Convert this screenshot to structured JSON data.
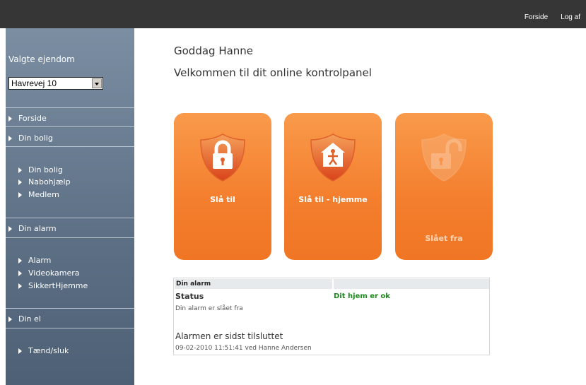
{
  "topbar": {
    "links": [
      "Forside",
      "Log af"
    ]
  },
  "sidebar": {
    "property_title": "Valgte ejendom",
    "property_selected": "Havrevej 10",
    "sections": {
      "forside": "Forside",
      "din_bolig": "Din bolig",
      "din_bolig_items": [
        "Din bolig",
        "Nabohjælp",
        "Medlem"
      ],
      "din_alarm": "Din alarm",
      "din_alarm_items": [
        "Alarm",
        "Videokamera",
        "SikkertHjemme"
      ],
      "din_el": "Din el",
      "din_el_items": [
        "Tænd/sluk"
      ]
    }
  },
  "main": {
    "greeting": "Goddag Hanne",
    "welcome": "Velkommen til dit online kontrolpanel",
    "tiles": [
      {
        "label": "Slå til",
        "icon": "lock-closed-icon"
      },
      {
        "label": "Slå til - hjemme",
        "icon": "home-person-icon"
      },
      {
        "label": "Slået fra",
        "icon": "lock-open-icon"
      }
    ],
    "status": {
      "header": "Din alarm",
      "label": "Status",
      "ok_text": "Dit hjem er ok",
      "desc": "Din alarm er slået fra",
      "last_title": "Alarmen er sidst tilsluttet",
      "last_time": "09-02-2010 11:51:41 ved Hanne Andersen"
    }
  },
  "colors": {
    "accent": "#f37e2d",
    "topbar": "#363636",
    "sidebar": "#6a7d92",
    "ok": "#1a8a1a"
  }
}
